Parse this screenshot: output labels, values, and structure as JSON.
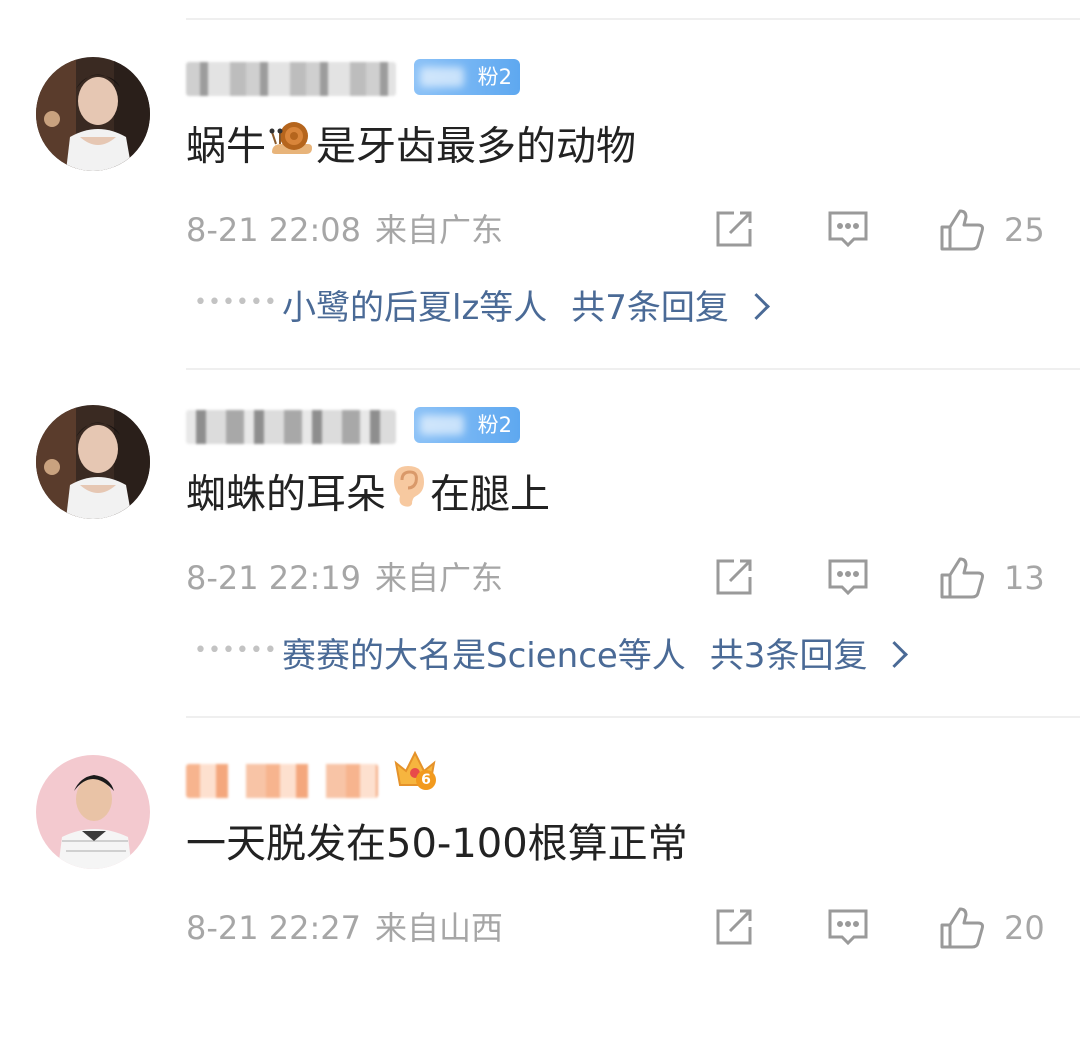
{
  "comments": [
    {
      "badge_text": "粉2",
      "content_before": "蜗牛",
      "emoji": "snail-emoji",
      "content_after": "是牙齿最多的动物",
      "time": "8-21 22:08",
      "location": "来自广东",
      "likes": "25",
      "replies_who": "小鹭的后夏lz等人",
      "replies_count": "共7条回复"
    },
    {
      "badge_text": "粉2",
      "content_before": "蜘蛛的耳朵",
      "emoji": "ear-emoji",
      "content_after": "在腿上",
      "time": "8-21 22:19",
      "location": "来自广东",
      "likes": "13",
      "replies_who": "赛赛的大名是Science等人",
      "replies_count": "共3条回复"
    },
    {
      "vip_level": "6",
      "content_before": "一天脱发在50-100根算正常",
      "content_after": "",
      "time": "8-21 22:27",
      "location": "来自山西",
      "likes": "20"
    }
  ],
  "colors": {
    "link": "#4a6a96",
    "meta": "#a6a6a6",
    "text": "#222222",
    "badge": "#6aaef2",
    "divider": "#efefef"
  }
}
